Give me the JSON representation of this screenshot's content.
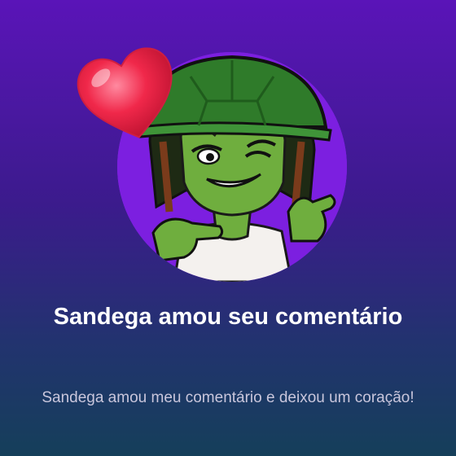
{
  "notification": {
    "title": "Sandega amou seu comentário",
    "description": "Sandega amou meu comentário e deixou um coração!"
  },
  "icons": {
    "avatar": "avatar-turtle-character",
    "reaction": "heart-icon"
  },
  "colors": {
    "background_top": "#5a14b8",
    "background_bottom": "#153f5a",
    "avatar_ring": "#7c1fe0",
    "heart": "#f0284a",
    "title_text": "#ffffff",
    "description_text": "#c9c6dc"
  }
}
